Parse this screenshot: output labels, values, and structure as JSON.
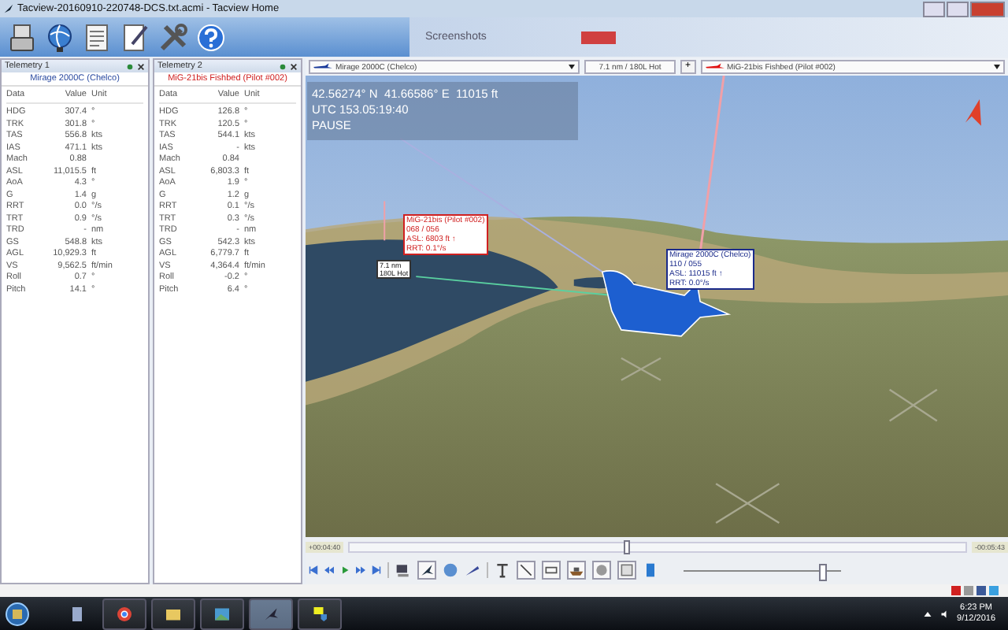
{
  "window": {
    "title": "Tacview-20160910-220748-DCS.txt.acmi - Tacview Home"
  },
  "toolbar": {
    "tab": "Screenshots"
  },
  "panels": [
    {
      "title": "Telemetry 1",
      "aircraft": "Mirage 2000C (Chelco)",
      "color": "#2a4aa0",
      "columns": [
        "Data",
        "Value",
        "Unit"
      ],
      "rows": [
        {
          "data": "HDG",
          "value": "307.4",
          "unit": "°"
        },
        {
          "data": "TRK",
          "value": "301.8",
          "unit": "°"
        },
        {
          "data": "TAS",
          "value": "556.8",
          "unit": "kts"
        },
        {
          "data": "IAS",
          "value": "471.1",
          "unit": "kts"
        },
        {
          "data": "Mach",
          "value": "0.88"
        },
        {
          "data": "ASL",
          "value": "11,015.5",
          "unit": "ft"
        },
        {
          "data": "AoA",
          "value": "4.3",
          "unit": "°"
        },
        {
          "data": "G",
          "value": "1.4",
          "unit": "g"
        },
        {
          "data": "RRT",
          "value": "0.0",
          "unit": "°/s"
        },
        {
          "data": "TRT",
          "value": "0.9",
          "unit": "°/s"
        },
        {
          "data": "TRD",
          "value": "-",
          "unit": "nm"
        },
        {
          "data": "GS",
          "value": "548.8",
          "unit": "kts"
        },
        {
          "data": "AGL",
          "value": "10,929.3",
          "unit": "ft"
        },
        {
          "data": "VS",
          "value": "9,562.5",
          "unit": "ft/min"
        },
        {
          "data": "Roll",
          "value": "0.7",
          "unit": "°"
        },
        {
          "data": "Pitch",
          "value": "14.1",
          "unit": "°"
        }
      ]
    },
    {
      "title": "Telemetry 2",
      "aircraft": "MiG-21bis Fishbed (Pilot #002)",
      "color": "#d02020",
      "columns": [
        "Data",
        "Value",
        "Unit"
      ],
      "rows": [
        {
          "data": "HDG",
          "value": "126.8",
          "unit": "°"
        },
        {
          "data": "TRK",
          "value": "120.5",
          "unit": "°"
        },
        {
          "data": "TAS",
          "value": "544.1",
          "unit": "kts"
        },
        {
          "data": "IAS",
          "value": "-",
          "unit": "kts"
        },
        {
          "data": "Mach",
          "value": "0.84"
        },
        {
          "data": "ASL",
          "value": "6,803.3",
          "unit": "ft"
        },
        {
          "data": "AoA",
          "value": "1.9",
          "unit": "°"
        },
        {
          "data": "G",
          "value": "1.2",
          "unit": "g"
        },
        {
          "data": "RRT",
          "value": "0.1",
          "unit": "°/s"
        },
        {
          "data": "TRT",
          "value": "0.3",
          "unit": "°/s"
        },
        {
          "data": "TRD",
          "value": "-",
          "unit": "nm"
        },
        {
          "data": "GS",
          "value": "542.3",
          "unit": "kts"
        },
        {
          "data": "AGL",
          "value": "6,779.7",
          "unit": "ft"
        },
        {
          "data": "VS",
          "value": "4,364.4",
          "unit": "ft/min"
        },
        {
          "data": "Roll",
          "value": "-0.2",
          "unit": "°"
        },
        {
          "data": "Pitch",
          "value": "6.4",
          "unit": "°"
        }
      ]
    }
  ],
  "view": {
    "left_aircraft": {
      "name": "Mirage 2000C (Chelco)",
      "color": "#1a3a9a"
    },
    "distance": "7.1 nm / 180L Hot",
    "add": "+",
    "right_aircraft": {
      "name": "MiG-21bis Fishbed (Pilot #002)",
      "color": "#e01010"
    },
    "hud": [
      "42.56274° N  41.66586° E  11015 ft",
      "UTC 153.05:19:40",
      "PAUSE"
    ],
    "labels": [
      {
        "lines": [
          "MiG-21bis (Pilot #002)",
          "068 / 056",
          "ASL: 6803 ft ↑",
          "RRT: 0.1°/s"
        ],
        "color": "#d02020"
      },
      {
        "lines": [
          "Mirage 2000C (Chelco)",
          "110 / 055",
          "ASL: 11015 ft ↑",
          "RRT: 0.0°/s"
        ],
        "color": "#1a2a8a"
      }
    ],
    "range_label": [
      "7.1 nm",
      "180L Hot"
    ]
  },
  "timeline": {
    "start": "+00:04:40",
    "end": "-00:05:43",
    "level": 0.45
  },
  "volume": {
    "level": 0.88
  },
  "taskbar": {
    "time": "6:23 PM",
    "date": "9/12/2016"
  }
}
